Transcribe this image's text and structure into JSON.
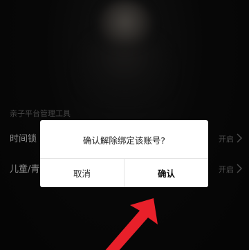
{
  "section": {
    "title": "亲子平台管理工具"
  },
  "rows": [
    {
      "label": "时间锁",
      "status": "开启"
    },
    {
      "label": "儿童/青",
      "status": "开启"
    }
  ],
  "dialog": {
    "message": "确认解除绑定该账号?",
    "cancel_label": "取消",
    "confirm_label": "确认"
  },
  "colors": {
    "background": "#0b0b0b",
    "dialog": "#ffffff",
    "arrow": "#e8202a"
  },
  "icons": {
    "chevron": "chevron-right-icon",
    "annotation": "red-arrow-icon"
  }
}
